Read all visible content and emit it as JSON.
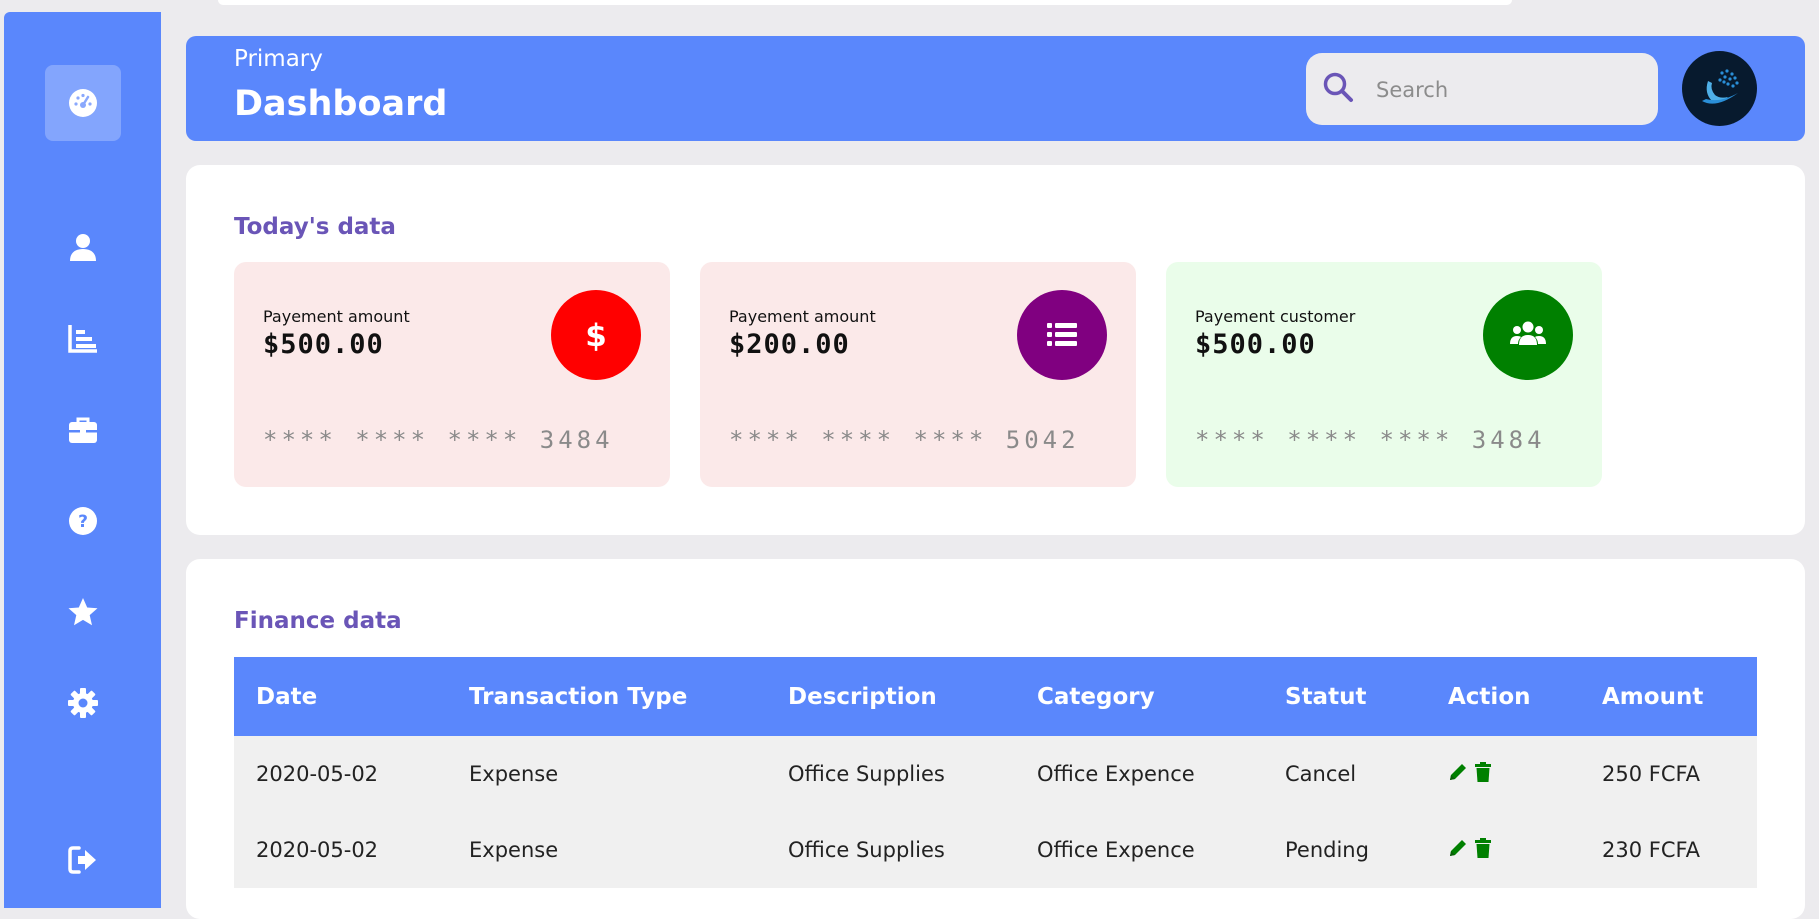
{
  "header": {
    "subtitle": "Primary",
    "title": "Dashboard",
    "search_placeholder": "Search"
  },
  "sidebar": {
    "items": [
      {
        "icon": "dashboard-gauge-icon",
        "active": true
      },
      {
        "icon": "user-icon"
      },
      {
        "icon": "bar-chart-icon"
      },
      {
        "icon": "briefcase-icon"
      },
      {
        "icon": "help-icon"
      },
      {
        "icon": "star-icon"
      },
      {
        "icon": "gear-icon"
      },
      {
        "icon": "logout-icon"
      }
    ]
  },
  "today": {
    "title": "Today's data",
    "cards": [
      {
        "label": "Payement amount",
        "amount": "$500.00",
        "card_number": "**** **** **** 3484",
        "icon": "dollar-icon",
        "bg": "#fbe9e9",
        "accent": "#ff0000"
      },
      {
        "label": "Payement amount",
        "amount": "$200.00",
        "card_number": "**** **** **** 5042",
        "icon": "list-icon",
        "bg": "#fbe9e9",
        "accent": "#800080"
      },
      {
        "label": "Payement customer",
        "amount": "$500.00",
        "card_number": "**** **** **** 3484",
        "icon": "users-icon",
        "bg": "#eafdea",
        "accent": "#008000"
      }
    ]
  },
  "finance": {
    "title": "Finance data",
    "columns": [
      "Date",
      "Transaction Type",
      "Description",
      "Category",
      "Statut",
      "Action",
      "Amount"
    ],
    "rows": [
      {
        "date": "2020-05-02",
        "type": "Expense",
        "description": "Office Supplies",
        "category": "Office Expence",
        "status": "Cancel",
        "amount": "250 FCFA"
      },
      {
        "date": "2020-05-02",
        "type": "Expense",
        "description": "Office Supplies",
        "category": "Office Expence",
        "status": "Pending",
        "amount": "230 FCFA"
      }
    ],
    "action_color": "#008000"
  },
  "colors": {
    "primary": "#5a87fc",
    "background": "#ecebee",
    "section_title": "#6a55b7"
  }
}
